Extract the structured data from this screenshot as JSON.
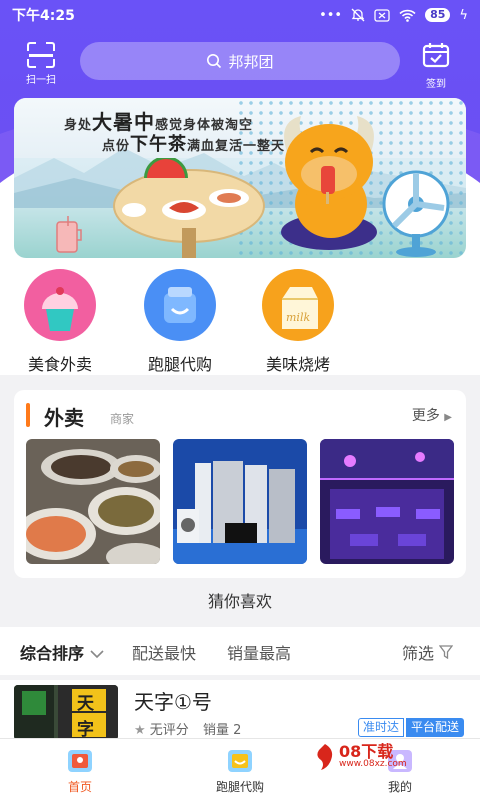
{
  "status_bar": {
    "time": "下午4:25",
    "battery": "85"
  },
  "header": {
    "scan_label": "扫一扫",
    "search_placeholder": "邦邦团",
    "checkin_label": "签到"
  },
  "banner": {
    "line1_pre": "身处",
    "line1_big": "大暑中",
    "line1_post": "感觉身体被淘空",
    "line2_pre": "点份",
    "line2_big": "下午茶",
    "line2_post": "满血复活一整天"
  },
  "categories": [
    {
      "label": "美食外卖",
      "icon": "cupcake-icon",
      "color": "#f25fa0"
    },
    {
      "label": "跑腿代购",
      "icon": "shopping-bag-icon",
      "color": "#4a8ff5"
    },
    {
      "label": "美味烧烤",
      "icon": "milk-carton-icon",
      "color": "#f7a21c"
    }
  ],
  "takeout": {
    "title": "外卖",
    "subtitle": "商家",
    "more": "更多",
    "images": [
      "seafood-dishes-photo",
      "home-appliances-photo",
      "nightclub-interior-photo"
    ]
  },
  "guess_title": "猜你喜欢",
  "sort_bar": {
    "options": [
      "综合排序",
      "配送最快",
      "销量最高"
    ],
    "filter": "筛选"
  },
  "store": {
    "name": "天字①号",
    "rating": "无评分",
    "sales": "销量 2",
    "tag_ontime": "准时达",
    "tag_platform": "平台配送",
    "sign_chars": [
      "天",
      "字"
    ]
  },
  "bottom_nav": [
    {
      "label": "首页",
      "active": true
    },
    {
      "label": "跑腿代购",
      "active": false
    },
    {
      "label": "我的",
      "active": false
    }
  ],
  "watermark": {
    "text": "08下载",
    "url": "www.08xz.com"
  },
  "colors": {
    "brand_purple": "#6b4ff2",
    "accent_orange": "#ff7a1a",
    "tag_blue": "#3a8bf0",
    "nav_active": "#f05a23"
  }
}
